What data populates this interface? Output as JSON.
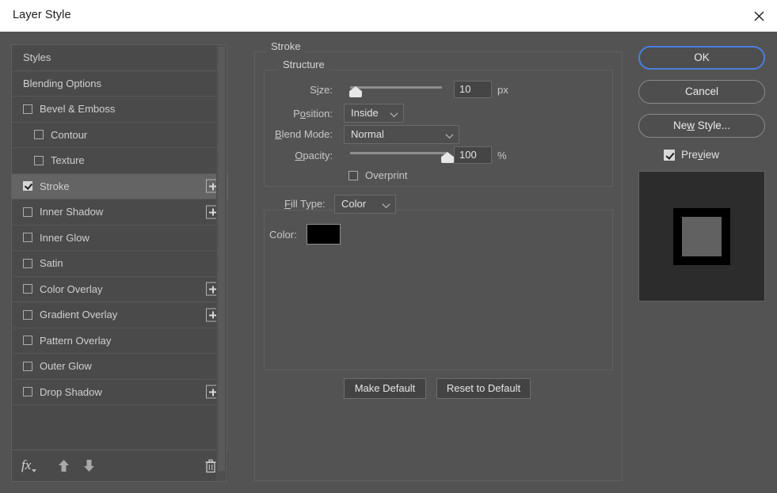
{
  "window": {
    "title": "Layer Style",
    "close_icon": "close-icon"
  },
  "effects_list": {
    "items": [
      {
        "label": "Styles",
        "type": "plain",
        "checkbox": false,
        "checked": false,
        "selected": false,
        "has_plus": false
      },
      {
        "label": "Blending Options",
        "type": "plain",
        "checkbox": false,
        "checked": false,
        "selected": false,
        "has_plus": false
      },
      {
        "label": "Bevel & Emboss",
        "type": "lvl0",
        "checkbox": true,
        "checked": false,
        "selected": false,
        "has_plus": false
      },
      {
        "label": "Contour",
        "type": "lvl1",
        "checkbox": true,
        "checked": false,
        "selected": false,
        "has_plus": false
      },
      {
        "label": "Texture",
        "type": "lvl1",
        "checkbox": true,
        "checked": false,
        "selected": false,
        "has_plus": false
      },
      {
        "label": "Stroke",
        "type": "lvl0",
        "checkbox": true,
        "checked": true,
        "selected": true,
        "has_plus": true
      },
      {
        "label": "Inner Shadow",
        "type": "lvl0",
        "checkbox": true,
        "checked": false,
        "selected": false,
        "has_plus": true
      },
      {
        "label": "Inner Glow",
        "type": "lvl0",
        "checkbox": true,
        "checked": false,
        "selected": false,
        "has_plus": false
      },
      {
        "label": "Satin",
        "type": "lvl0",
        "checkbox": true,
        "checked": false,
        "selected": false,
        "has_plus": false
      },
      {
        "label": "Color Overlay",
        "type": "lvl0",
        "checkbox": true,
        "checked": false,
        "selected": false,
        "has_plus": true
      },
      {
        "label": "Gradient Overlay",
        "type": "lvl0",
        "checkbox": true,
        "checked": false,
        "selected": false,
        "has_plus": true
      },
      {
        "label": "Pattern Overlay",
        "type": "lvl0",
        "checkbox": true,
        "checked": false,
        "selected": false,
        "has_plus": false
      },
      {
        "label": "Outer Glow",
        "type": "lvl0",
        "checkbox": true,
        "checked": false,
        "selected": false,
        "has_plus": false
      },
      {
        "label": "Drop Shadow",
        "type": "lvl0",
        "checkbox": true,
        "checked": false,
        "selected": false,
        "has_plus": true
      }
    ],
    "toolbar": {
      "fx_label": "fx",
      "fx_icon": "fx-menu-icon",
      "move_up_icon": "arrow-up-icon",
      "move_down_icon": "arrow-down-icon",
      "delete_icon": "trash-icon"
    }
  },
  "stroke_panel": {
    "group_title": "Stroke",
    "structure": {
      "group_title": "Structure",
      "size": {
        "label_pre": "S",
        "label_accel": "i",
        "label_post": "ze:",
        "value": "10",
        "unit": "px",
        "slider_percent": 6
      },
      "position": {
        "label_pre": "P",
        "label_accel": "o",
        "label_post": "sition:",
        "value": "Inside"
      },
      "blend_mode": {
        "label_pre": "",
        "label_accel": "B",
        "label_post": "lend Mode:",
        "value": "Normal"
      },
      "opacity": {
        "label_pre": "",
        "label_accel": "O",
        "label_post": "pacity:",
        "value": "100",
        "unit": "%",
        "slider_percent": 100
      },
      "overprint": {
        "label": "Overprint",
        "checked": false
      }
    },
    "fill": {
      "fill_type": {
        "label_pre": "",
        "label_accel": "F",
        "label_post": "ill Type:",
        "value": "Color"
      },
      "color": {
        "label": "Color:",
        "value": "#000000"
      }
    },
    "buttons": {
      "make_default": "Make Default",
      "reset_to_default": "Reset to Default"
    }
  },
  "actions": {
    "ok": "OK",
    "cancel": "Cancel",
    "new_style_pre": "Ne",
    "new_style_accel": "w",
    "new_style_post": " Style...",
    "preview_pre": "Pre",
    "preview_accel": "v",
    "preview_post": "iew",
    "preview_checked": true,
    "focus_color": "#4a7fe0"
  },
  "preview": {
    "background": "#2c2c2c",
    "shape_fill": "#616161",
    "stroke_color": "#000000"
  }
}
